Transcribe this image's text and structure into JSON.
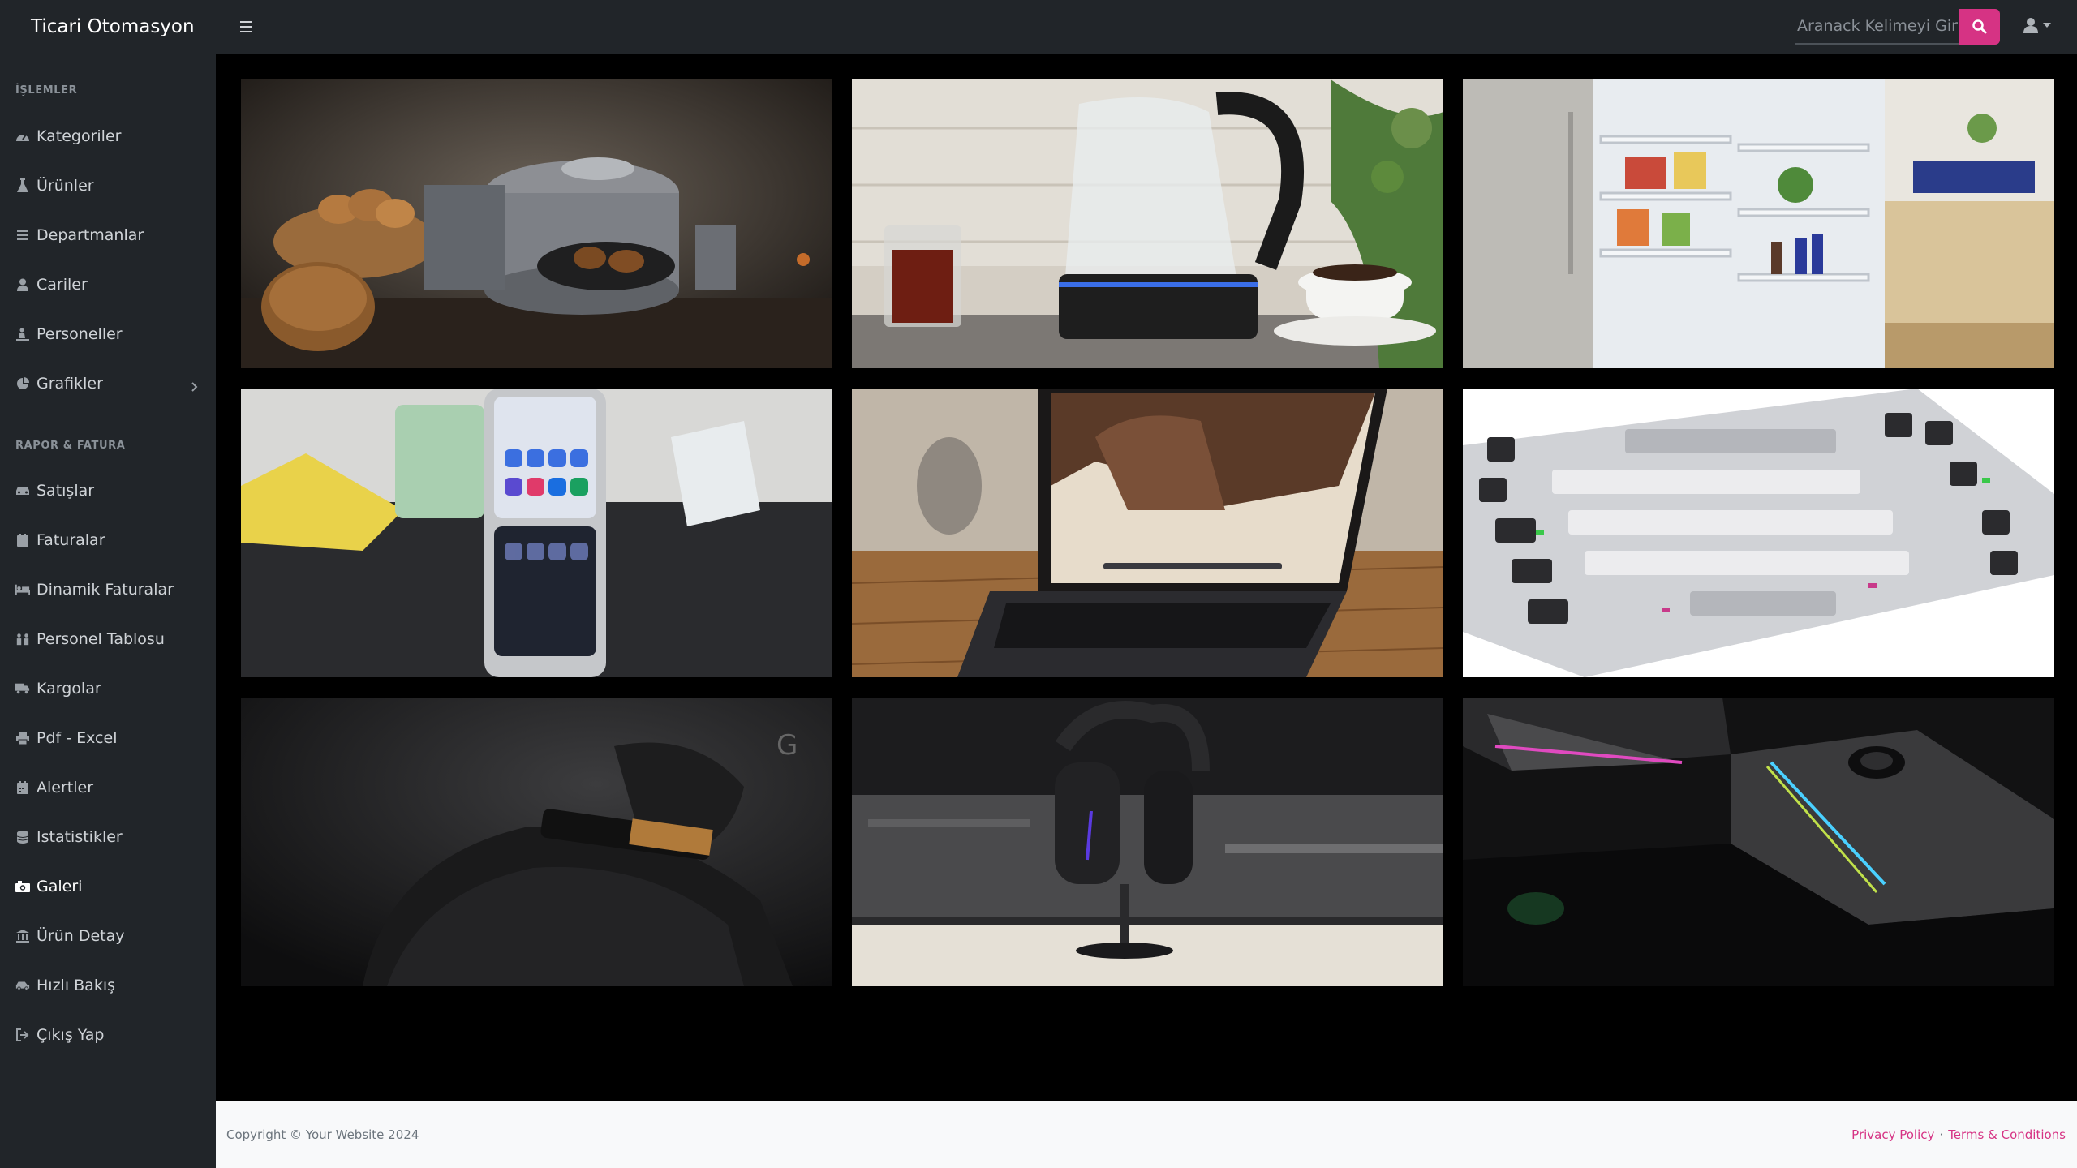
{
  "app": {
    "title": "Ticari Otomasyon"
  },
  "search": {
    "placeholder": "Aranack Kelimeyi Girin..."
  },
  "sidebar": {
    "sections": [
      {
        "heading": "İŞLEMLER"
      },
      {
        "heading": "RAPOR & FATURA"
      }
    ],
    "items": [
      {
        "label": "Kategoriler",
        "icon": "dashboard-icon"
      },
      {
        "label": "Ürünler",
        "icon": "flask-icon"
      },
      {
        "label": "Departmanlar",
        "icon": "list-icon"
      },
      {
        "label": "Cariler",
        "icon": "user-icon"
      },
      {
        "label": "Personeller",
        "icon": "person-digging-icon"
      },
      {
        "label": "Grafikler",
        "icon": "pie-chart-icon"
      },
      {
        "label": "Satışlar",
        "icon": "car-icon"
      },
      {
        "label": "Faturalar",
        "icon": "calendar-icon"
      },
      {
        "label": "Dinamik Faturalar",
        "icon": "bed-icon"
      },
      {
        "label": "Personel Tablosu",
        "icon": "people-icon"
      },
      {
        "label": "Kargolar",
        "icon": "truck-icon"
      },
      {
        "label": "Pdf - Excel",
        "icon": "print-icon"
      },
      {
        "label": "Alertler",
        "icon": "calendar-alt-icon"
      },
      {
        "label": "Istatistikler",
        "icon": "database-icon"
      },
      {
        "label": "Galeri",
        "icon": "camera-icon"
      },
      {
        "label": "Ürün Detay",
        "icon": "building-columns-icon"
      },
      {
        "label": "Hızlı Bakış",
        "icon": "car-side-icon"
      },
      {
        "label": "Çıkış Yap",
        "icon": "sign-out-icon"
      }
    ],
    "active_item": "Galeri"
  },
  "gallery": {
    "images": [
      {
        "subject": "oven"
      },
      {
        "subject": "kettle"
      },
      {
        "subject": "fridge"
      },
      {
        "subject": "phone"
      },
      {
        "subject": "laptop"
      },
      {
        "subject": "keyboard"
      },
      {
        "subject": "mouse"
      },
      {
        "subject": "headset"
      },
      {
        "subject": "speaker"
      }
    ]
  },
  "footer": {
    "copyright": "Copyright © Your Website 2024",
    "privacy": "Privacy Policy",
    "separator": "·",
    "terms": "Terms & Conditions"
  },
  "colors": {
    "navbar_bg": "#212529",
    "accent": "#d63384",
    "content_bg": "#000000",
    "footer_bg": "#f8f9fa"
  }
}
